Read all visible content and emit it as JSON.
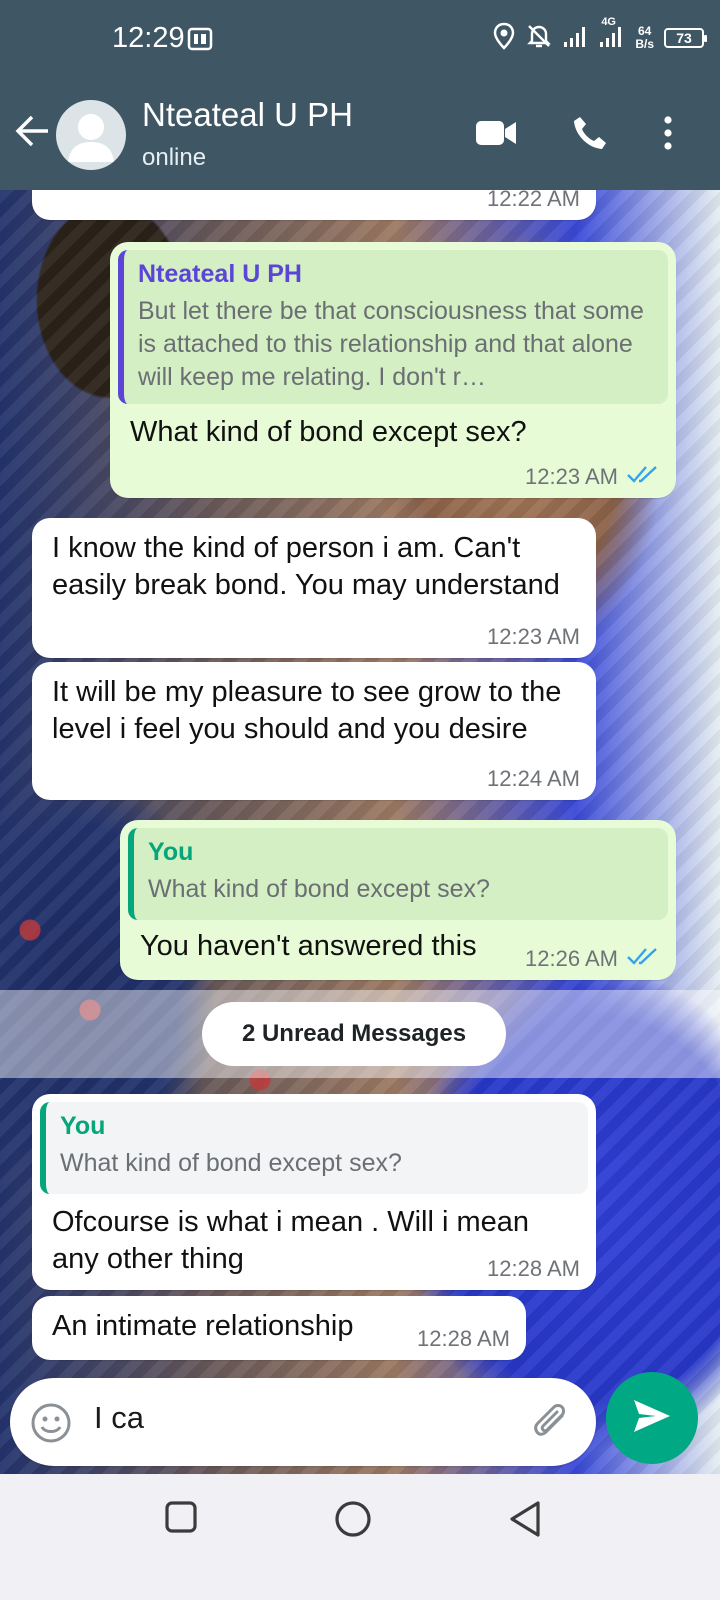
{
  "status_bar": {
    "time": "12:29",
    "network": "4G",
    "speed_value": "64",
    "speed_unit": "B/s",
    "battery": "73"
  },
  "header": {
    "contact_name": "Nteateal U PH",
    "contact_status": "online"
  },
  "messages": [
    {
      "type": "in",
      "time": "12:22 AM"
    },
    {
      "type": "out",
      "quote_name": "Nteateal U PH",
      "quote_text": "But let there be that consciousness that some is attached to this relationship and that alone will keep me relating. I don't r…",
      "text": "What kind of bond except sex?",
      "time": "12:23 AM",
      "read": true
    },
    {
      "type": "in",
      "text": "I know the kind of person i am. Can't easily break bond. You may understand",
      "time": "12:23 AM"
    },
    {
      "type": "in",
      "text": "It will be my pleasure to see grow to the level i feel you should and you desire",
      "time": "12:24 AM"
    },
    {
      "type": "out",
      "quote_name": "You",
      "quote_text": "What kind of bond except sex?",
      "text": "You haven't answered this",
      "time": "12:26 AM",
      "read": true
    },
    {
      "type": "in",
      "quote_name": "You",
      "quote_text": "What kind of bond except sex?",
      "text": "Ofcourse is what i mean . Will i mean any other thing",
      "time": "12:28 AM"
    },
    {
      "type": "in",
      "text": "An intimate relationship",
      "time": "12:28 AM"
    }
  ],
  "unread_label": "2 Unread Messages",
  "composer": {
    "value": "I ca"
  },
  "colors": {
    "header_bg": "#3f5664",
    "outgoing_bubble": "#e7fcd6",
    "incoming_bubble": "#ffffff",
    "accent_green": "#00a884",
    "quote_contact": "#5b45d6",
    "quote_you": "#06a67a",
    "read_ticks": "#34a3ea"
  }
}
